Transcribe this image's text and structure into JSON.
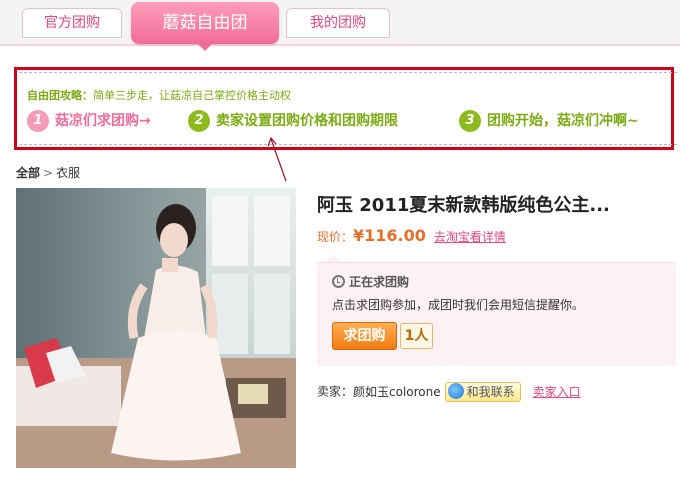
{
  "tabs": [
    {
      "label": "官方团购",
      "active": false
    },
    {
      "label": "蘑菇自由团",
      "active": true
    },
    {
      "label": "我的团购",
      "active": false
    }
  ],
  "guide": {
    "title": "自由团攻略：",
    "subtitle": "简单三步走，让菇凉自己掌控价格主动权",
    "steps": [
      {
        "num": "1",
        "text": "菇凉们求团购→"
      },
      {
        "num": "2",
        "text": "卖家设置团购价格和团购期限"
      },
      {
        "num": "3",
        "text": "团购开始，菇凉们冲啊~"
      }
    ]
  },
  "breadcrumb": {
    "root": "全部",
    "separator": ">",
    "current": "衣服"
  },
  "product": {
    "title": "阿玉 2011夏末新款韩版纯色公主...",
    "price_label": "现价：",
    "price": "¥116.00",
    "taobao_link": "去淘宝看详情"
  },
  "group": {
    "status": "正在求团购",
    "notice": "点击求团购参加，成团时我们会用短信提醒你。",
    "buy_label": "求团购",
    "count": "1人"
  },
  "seller": {
    "label": "卖家：",
    "name": "颜如玉colorone",
    "contact_label": "和我联系",
    "shop_link": "卖家入口"
  },
  "colors": {
    "accent_pink": "#f06c98",
    "guide_green": "#7cab13",
    "price_orange": "#e76f2a",
    "highlight_red": "#d0021b"
  },
  "icons": [
    "clock-icon",
    "wangwang-icon",
    "arrow-icon"
  ]
}
